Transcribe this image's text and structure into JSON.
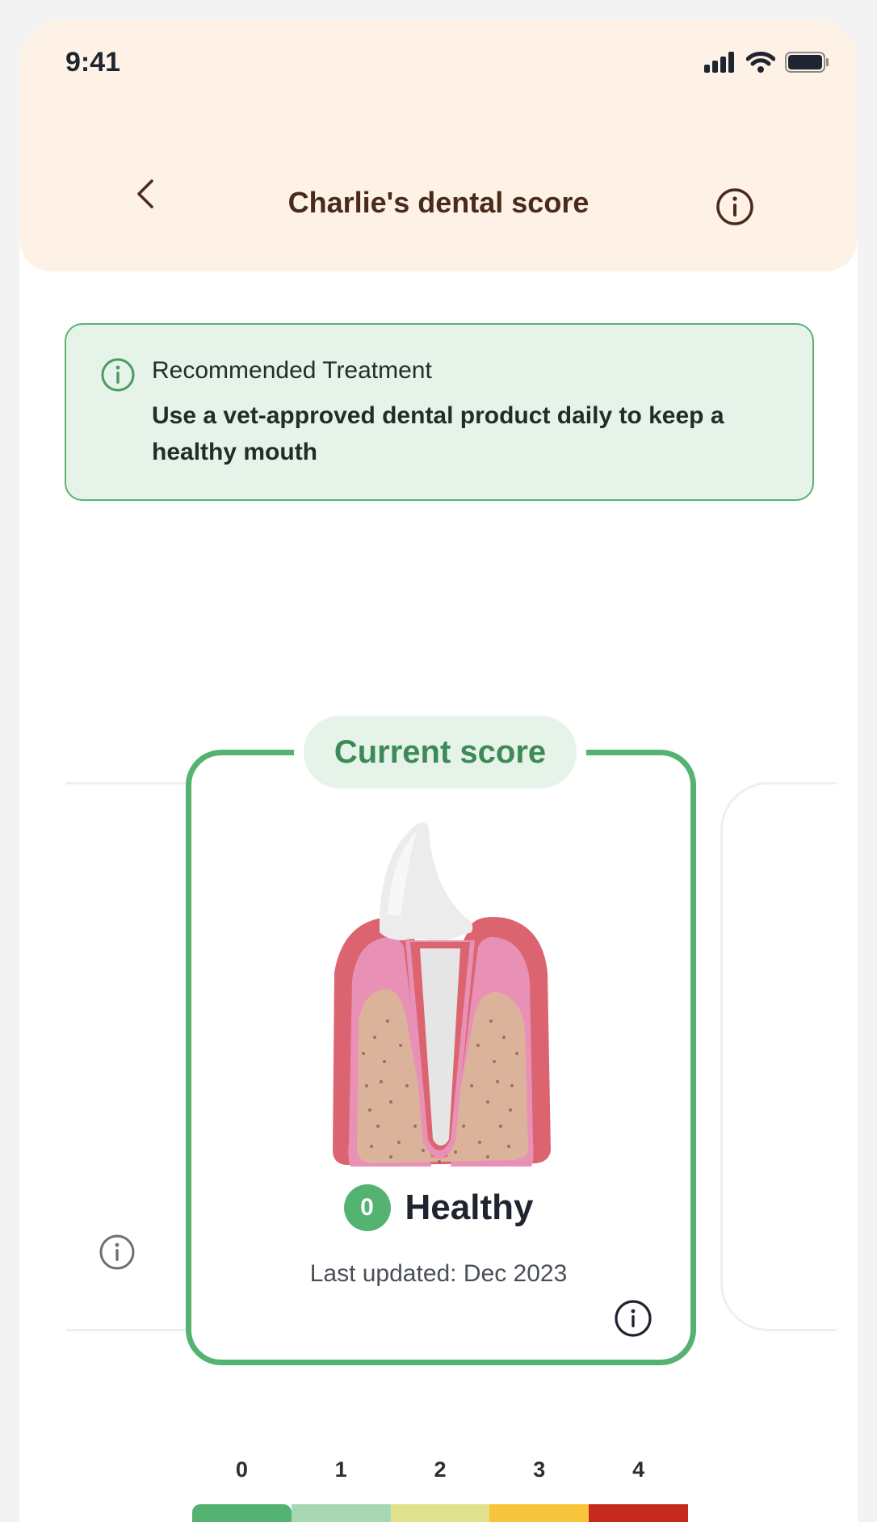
{
  "status_bar": {
    "time": "9:41"
  },
  "header": {
    "title": "Charlie's dental score"
  },
  "treatment": {
    "label": "Recommended Treatment",
    "body": "Use a vet-approved dental product daily to keep a healthy mouth"
  },
  "score_card": {
    "pill_label": "Current score",
    "score": "0",
    "status": "Healthy",
    "updated": "Last updated:  Dec 2023"
  },
  "scale": {
    "levels": [
      "0",
      "1",
      "2",
      "3",
      "4"
    ],
    "colors": [
      "#55b371",
      "#a8d8b3",
      "#e3e28c",
      "#f7c43b",
      "#c62a1f"
    ]
  },
  "colors": {
    "accent_green": "#55b371",
    "header_bg": "#fdf2e5",
    "title_brown": "#4a2a1c"
  }
}
